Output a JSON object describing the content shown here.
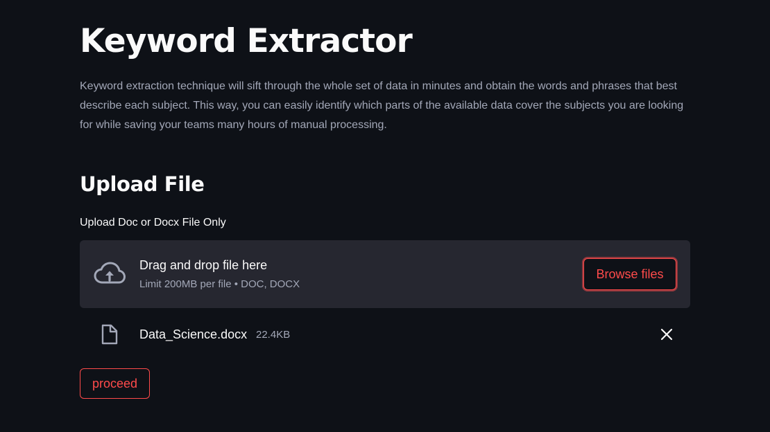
{
  "page": {
    "title": "Keyword Extractor",
    "description": "Keyword extraction technique will sift through the whole set of data in minutes and obtain the words and phrases that best describe each subject. This way, you can easily identify which parts of the available data cover the subjects you are looking for while saving your teams many hours of manual processing."
  },
  "upload": {
    "section_title": "Upload File",
    "label": "Upload Doc or Docx File Only",
    "dropzone": {
      "icon": "cloud-upload-icon",
      "main_text": "Drag and drop file here",
      "sub_text": "Limit 200MB per file • DOC, DOCX",
      "browse_label": "Browse files"
    },
    "file": {
      "icon": "file-icon",
      "name": "Data_Science.docx",
      "size": "22.4KB",
      "remove_icon": "close-icon"
    }
  },
  "actions": {
    "proceed_label": "proceed"
  },
  "colors": {
    "background": "#0e1117",
    "surface": "#262730",
    "accent": "#ff4b4b",
    "text": "#fafafa",
    "muted_text": "#a3a8b8"
  }
}
